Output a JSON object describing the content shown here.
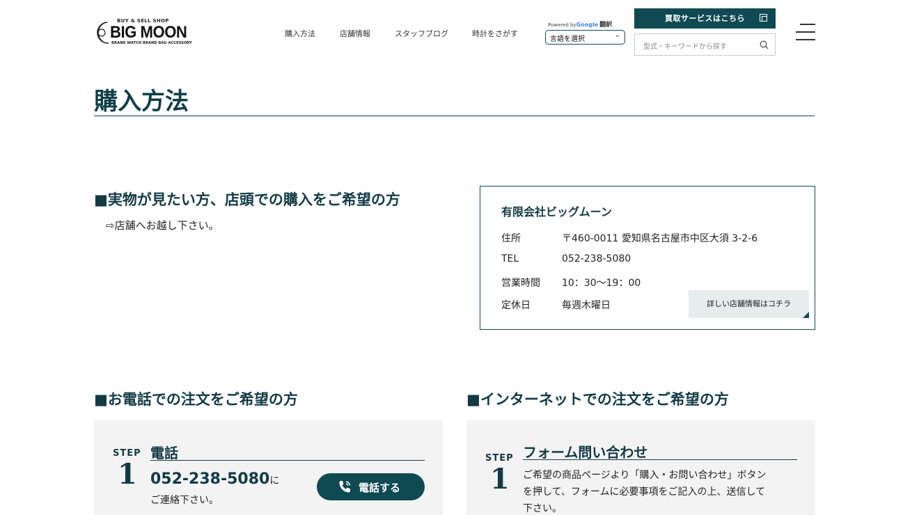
{
  "header": {
    "logo": {
      "top": "BUY & SELL SHOP",
      "main": "BIG MOON",
      "sub": "BRAND WATCH BRAND BAG ACCESSORY"
    },
    "nav": [
      "購入方法",
      "店舗情報",
      "スタッフブログ",
      "時計をさがす"
    ],
    "translate": {
      "powered": "Powered by",
      "google": "Google",
      "label": "翻訳",
      "select": "言語を選択"
    },
    "kaitori_button": "買取サービスはこちら",
    "search_placeholder": "型式・キーワードから探す"
  },
  "page_title": "購入方法",
  "store_section": {
    "heading": "■実物が見たい方、店頭での購入をご希望の方",
    "note": "⇨店舗へお越し下さい。",
    "company": "有限会社ビッグムーン",
    "rows": [
      {
        "label": "住所",
        "value": "〒460-0011 愛知県名古屋市中区大須 3-2-6"
      },
      {
        "label": "TEL",
        "value": "052-238-5080"
      },
      {
        "label": "営業時間",
        "value": "10：30〜19：00"
      },
      {
        "label": "定休日",
        "value": "毎週木曜日"
      }
    ],
    "detail_button": "詳しい店舗情報はコチラ"
  },
  "phone_section": {
    "heading": "■お電話での注文をご希望の方",
    "step_label": "STEP",
    "step_number": "1",
    "title": "電話",
    "phone": "052-238-5080",
    "phone_suffix": "に",
    "sub": "ご連絡下さい。",
    "call_button": "電話する"
  },
  "internet_section": {
    "heading": "■インターネットでの注文をご希望の方",
    "step_label": "STEP",
    "step_number": "1",
    "title": "フォーム問い合わせ",
    "text_lines": [
      "ご希望の商品ページより「購入・お問い合わせ」ボタン",
      "を押して、フォームに必要事項をご記入の上、送信して",
      "下さい。"
    ]
  },
  "colors": {
    "brand": "#0f4a52",
    "heading": "#123a45",
    "panel": "#f3f3f3"
  }
}
